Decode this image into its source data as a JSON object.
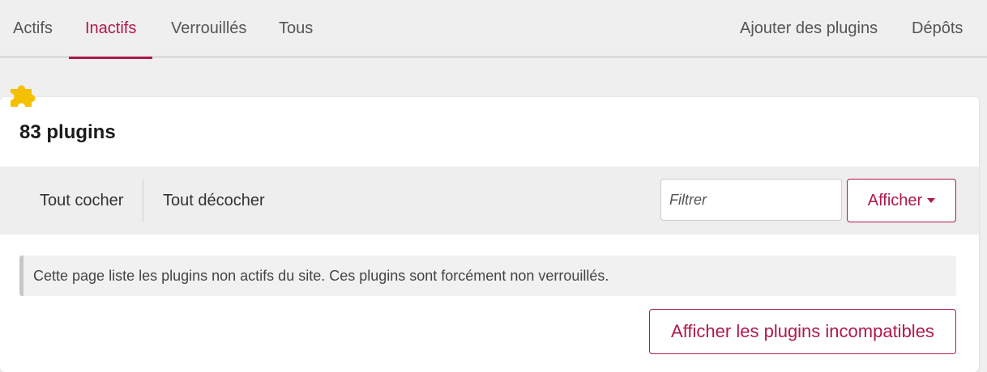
{
  "tabs": {
    "left": [
      {
        "label": "Actifs"
      },
      {
        "label": "Inactifs"
      },
      {
        "label": "Verrouillés"
      },
      {
        "label": "Tous"
      }
    ],
    "right": [
      {
        "label": "Ajouter des plugins"
      },
      {
        "label": "Dépôts"
      }
    ],
    "active": "Inactifs",
    "active_color": "#b0174e"
  },
  "header": {
    "icon": "puzzle-icon",
    "title": "83 plugins"
  },
  "toolbar": {
    "check_all": "Tout cocher",
    "uncheck_all": "Tout décocher",
    "filter_placeholder": "Filtrer",
    "show_label": "Afficher",
    "show_icon": "caret-down-icon"
  },
  "notice": {
    "text": "Cette page liste les plugins non actifs du site. Ces plugins sont forcément non verrouillés."
  },
  "actions": {
    "show_incompatible": "Afficher les plugins incompatibles"
  },
  "colors": {
    "accent": "#b0174e",
    "icon": "#f5c000",
    "toolbar_bg": "#eeeeee",
    "page_bg": "#efefef"
  }
}
